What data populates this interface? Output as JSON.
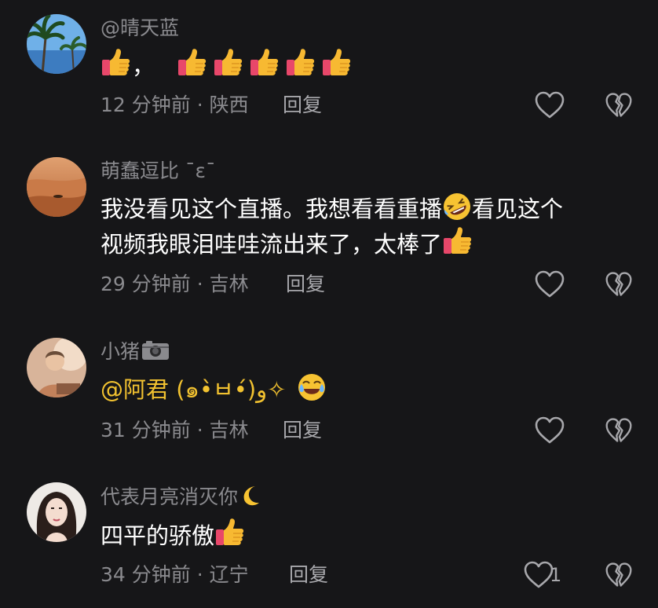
{
  "comments": [
    {
      "username": "@晴天蓝",
      "text_parts": [
        "，"
      ],
      "time": "12 分钟前 · 陕西",
      "reply": "回复",
      "likes": ""
    },
    {
      "username": "萌蠢逗比 ˉɛˉ",
      "line1": "我没看见这个直播。我想看看重播",
      "line1b": "看见这个",
      "line2": "视频我眼泪哇哇流出来了，太棒了",
      "time": "29 分钟前 · 吉林",
      "reply": "回复",
      "likes": ""
    },
    {
      "username": "小猪",
      "mention": "@阿君 (๑•̀ㅂ•́)و✧",
      "time": "31 分钟前 · 吉林",
      "reply": "回复",
      "likes": ""
    },
    {
      "username": "代表月亮消灭你",
      "text": "四平的骄傲",
      "time": "34 分钟前 · 辽宁",
      "reply": "回复",
      "likes": "1"
    }
  ],
  "icons": {
    "like": "heart-outline-icon",
    "dislike": "broken-heart-icon",
    "thumbs_up": "thumbs-up-emoji",
    "laughing": "rofl-emoji",
    "crying": "crying-laughing-emoji",
    "camera": "camera-emoji",
    "moon": "crescent-moon-emoji"
  },
  "colors": {
    "background": "#161618",
    "muted_text": "#8a8a8e",
    "mention": "#f2c230"
  }
}
